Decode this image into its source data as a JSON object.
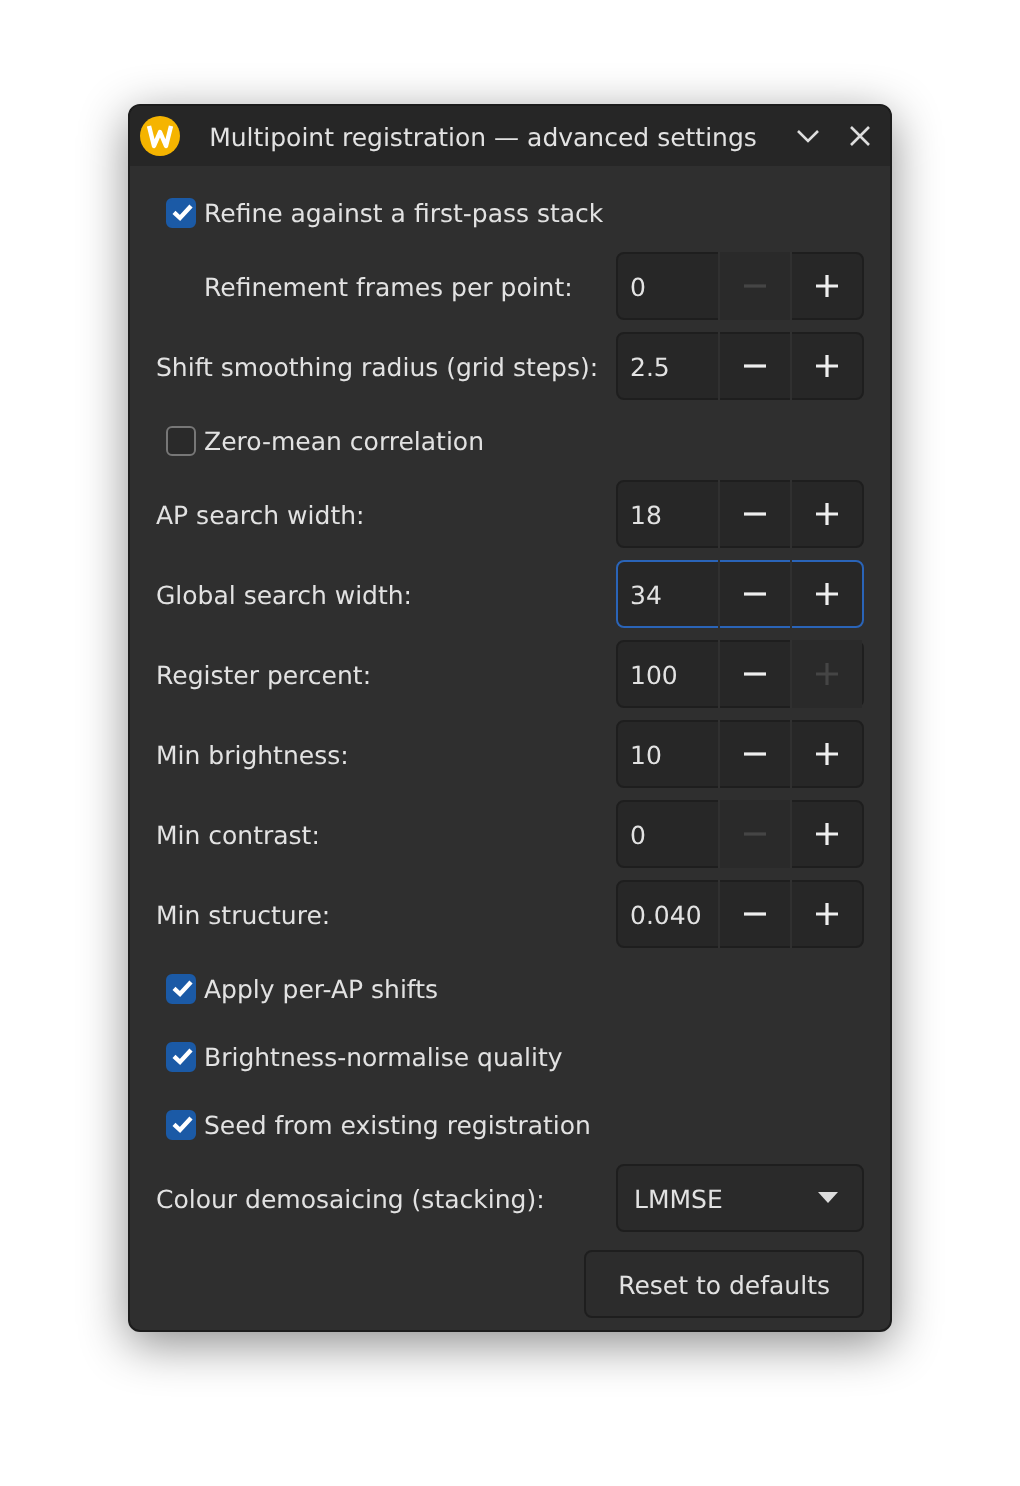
{
  "window": {
    "title": "Multipoint registration — advanced settings"
  },
  "rows": [
    {
      "kind": "checkbox",
      "label": "Refine against a first-pass stack",
      "checked": true
    },
    {
      "kind": "spin",
      "label": "Refinement frames per point:",
      "indented": true,
      "value": "0",
      "minus_disabled": true,
      "plus_disabled": false,
      "focused": false
    },
    {
      "kind": "spin",
      "label": "Shift smoothing radius (grid steps):",
      "indented": false,
      "value": "2.5",
      "minus_disabled": false,
      "plus_disabled": false,
      "focused": false
    },
    {
      "kind": "checkbox",
      "label": "Zero-mean correlation",
      "checked": false
    },
    {
      "kind": "spin",
      "label": "AP search width:",
      "indented": false,
      "value": "18",
      "minus_disabled": false,
      "plus_disabled": false,
      "focused": false
    },
    {
      "kind": "spin",
      "label": "Global search width:",
      "indented": false,
      "value": "34",
      "minus_disabled": false,
      "plus_disabled": false,
      "focused": true
    },
    {
      "kind": "spin",
      "label": "Register percent:",
      "indented": false,
      "value": "100",
      "minus_disabled": false,
      "plus_disabled": true,
      "focused": false
    },
    {
      "kind": "spin",
      "label": "Min brightness:",
      "indented": false,
      "value": "10",
      "minus_disabled": false,
      "plus_disabled": false,
      "focused": false
    },
    {
      "kind": "spin",
      "label": "Min contrast:",
      "indented": false,
      "value": "0",
      "minus_disabled": true,
      "plus_disabled": false,
      "focused": false
    },
    {
      "kind": "spin",
      "label": "Min structure:",
      "indented": false,
      "value": "0.040",
      "minus_disabled": false,
      "plus_disabled": false,
      "focused": false
    },
    {
      "kind": "checkbox",
      "label": "Apply per-AP shifts",
      "checked": true
    },
    {
      "kind": "checkbox",
      "label": "Brightness-normalise quality",
      "checked": true
    },
    {
      "kind": "checkbox",
      "label": "Seed from existing registration",
      "checked": true
    },
    {
      "kind": "combo",
      "label": "Colour demosaicing (stacking):",
      "value": "LMMSE"
    }
  ],
  "buttons": [
    "Reset to defaults"
  ]
}
